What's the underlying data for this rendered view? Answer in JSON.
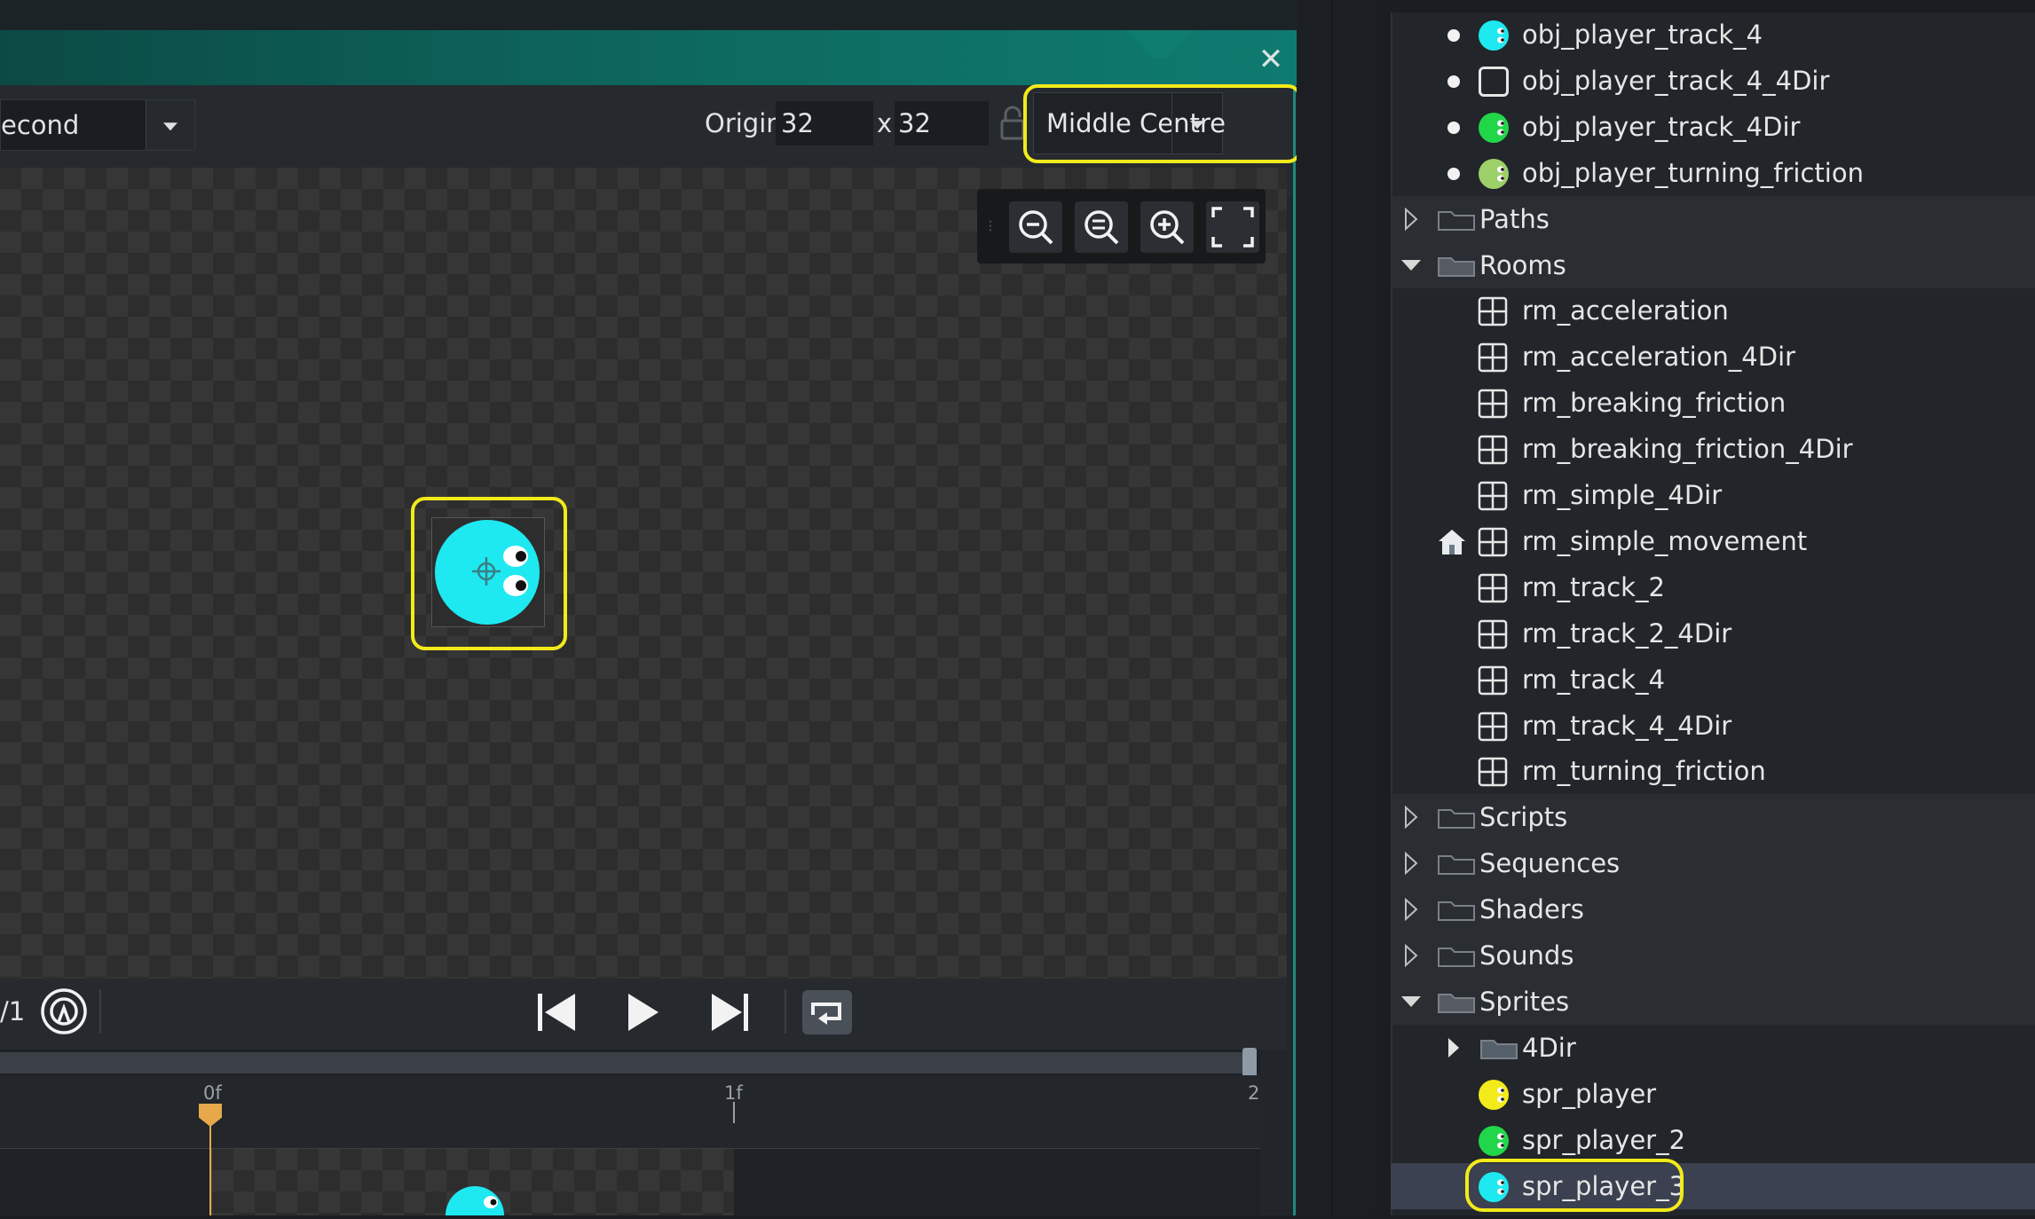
{
  "editor": {
    "close_glyph": "✕",
    "speed_value": "econd",
    "origin_label": "Origin",
    "origin_x": "32",
    "origin_sep": "x",
    "origin_y": "32",
    "origin_preset": "Middle Centre",
    "frame_count": "/1",
    "timeline_labels": [
      "0f",
      "1f",
      "2"
    ]
  },
  "assets": {
    "rows": [
      {
        "label": "obj_player_track_4",
        "kind": "object",
        "color": "#1ee8f0"
      },
      {
        "label": "obj_player_track_4_4Dir",
        "kind": "object-empty",
        "color": "#22262a"
      },
      {
        "label": "obj_player_track_4Dir",
        "kind": "object",
        "color": "#22d64a"
      },
      {
        "label": "obj_player_turning_friction",
        "kind": "object",
        "color": "#9ed06a"
      },
      {
        "label": "Paths",
        "kind": "folder",
        "expanded": false
      },
      {
        "label": "Rooms",
        "kind": "folder",
        "expanded": true
      },
      {
        "label": "rm_acceleration",
        "kind": "room"
      },
      {
        "label": "rm_acceleration_4Dir",
        "kind": "room"
      },
      {
        "label": "rm_breaking_friction",
        "kind": "room"
      },
      {
        "label": "rm_breaking_friction_4Dir",
        "kind": "room"
      },
      {
        "label": "rm_simple_4Dir",
        "kind": "room"
      },
      {
        "label": "rm_simple_movement",
        "kind": "room-home"
      },
      {
        "label": "rm_track_2",
        "kind": "room"
      },
      {
        "label": "rm_track_2_4Dir",
        "kind": "room"
      },
      {
        "label": "rm_track_4",
        "kind": "room"
      },
      {
        "label": "rm_track_4_4Dir",
        "kind": "room"
      },
      {
        "label": "rm_turning_friction",
        "kind": "room"
      },
      {
        "label": "Scripts",
        "kind": "folder",
        "expanded": false
      },
      {
        "label": "Sequences",
        "kind": "folder",
        "expanded": false
      },
      {
        "label": "Shaders",
        "kind": "folder",
        "expanded": false
      },
      {
        "label": "Sounds",
        "kind": "folder",
        "expanded": false
      },
      {
        "label": "Sprites",
        "kind": "folder",
        "expanded": true
      },
      {
        "label": "4Dir",
        "kind": "subfolder",
        "expanded": false
      },
      {
        "label": "spr_player",
        "kind": "sprite",
        "color": "#f2ea1a"
      },
      {
        "label": "spr_player_2",
        "kind": "sprite",
        "color": "#22d64a"
      },
      {
        "label": "spr_player_3",
        "kind": "sprite",
        "color": "#1ee8f0",
        "selected": true
      }
    ]
  },
  "colors": {
    "highlight": "#f2ea1a",
    "sprite_fill": "#1ee8f0",
    "playhead": "#e6a84a"
  }
}
